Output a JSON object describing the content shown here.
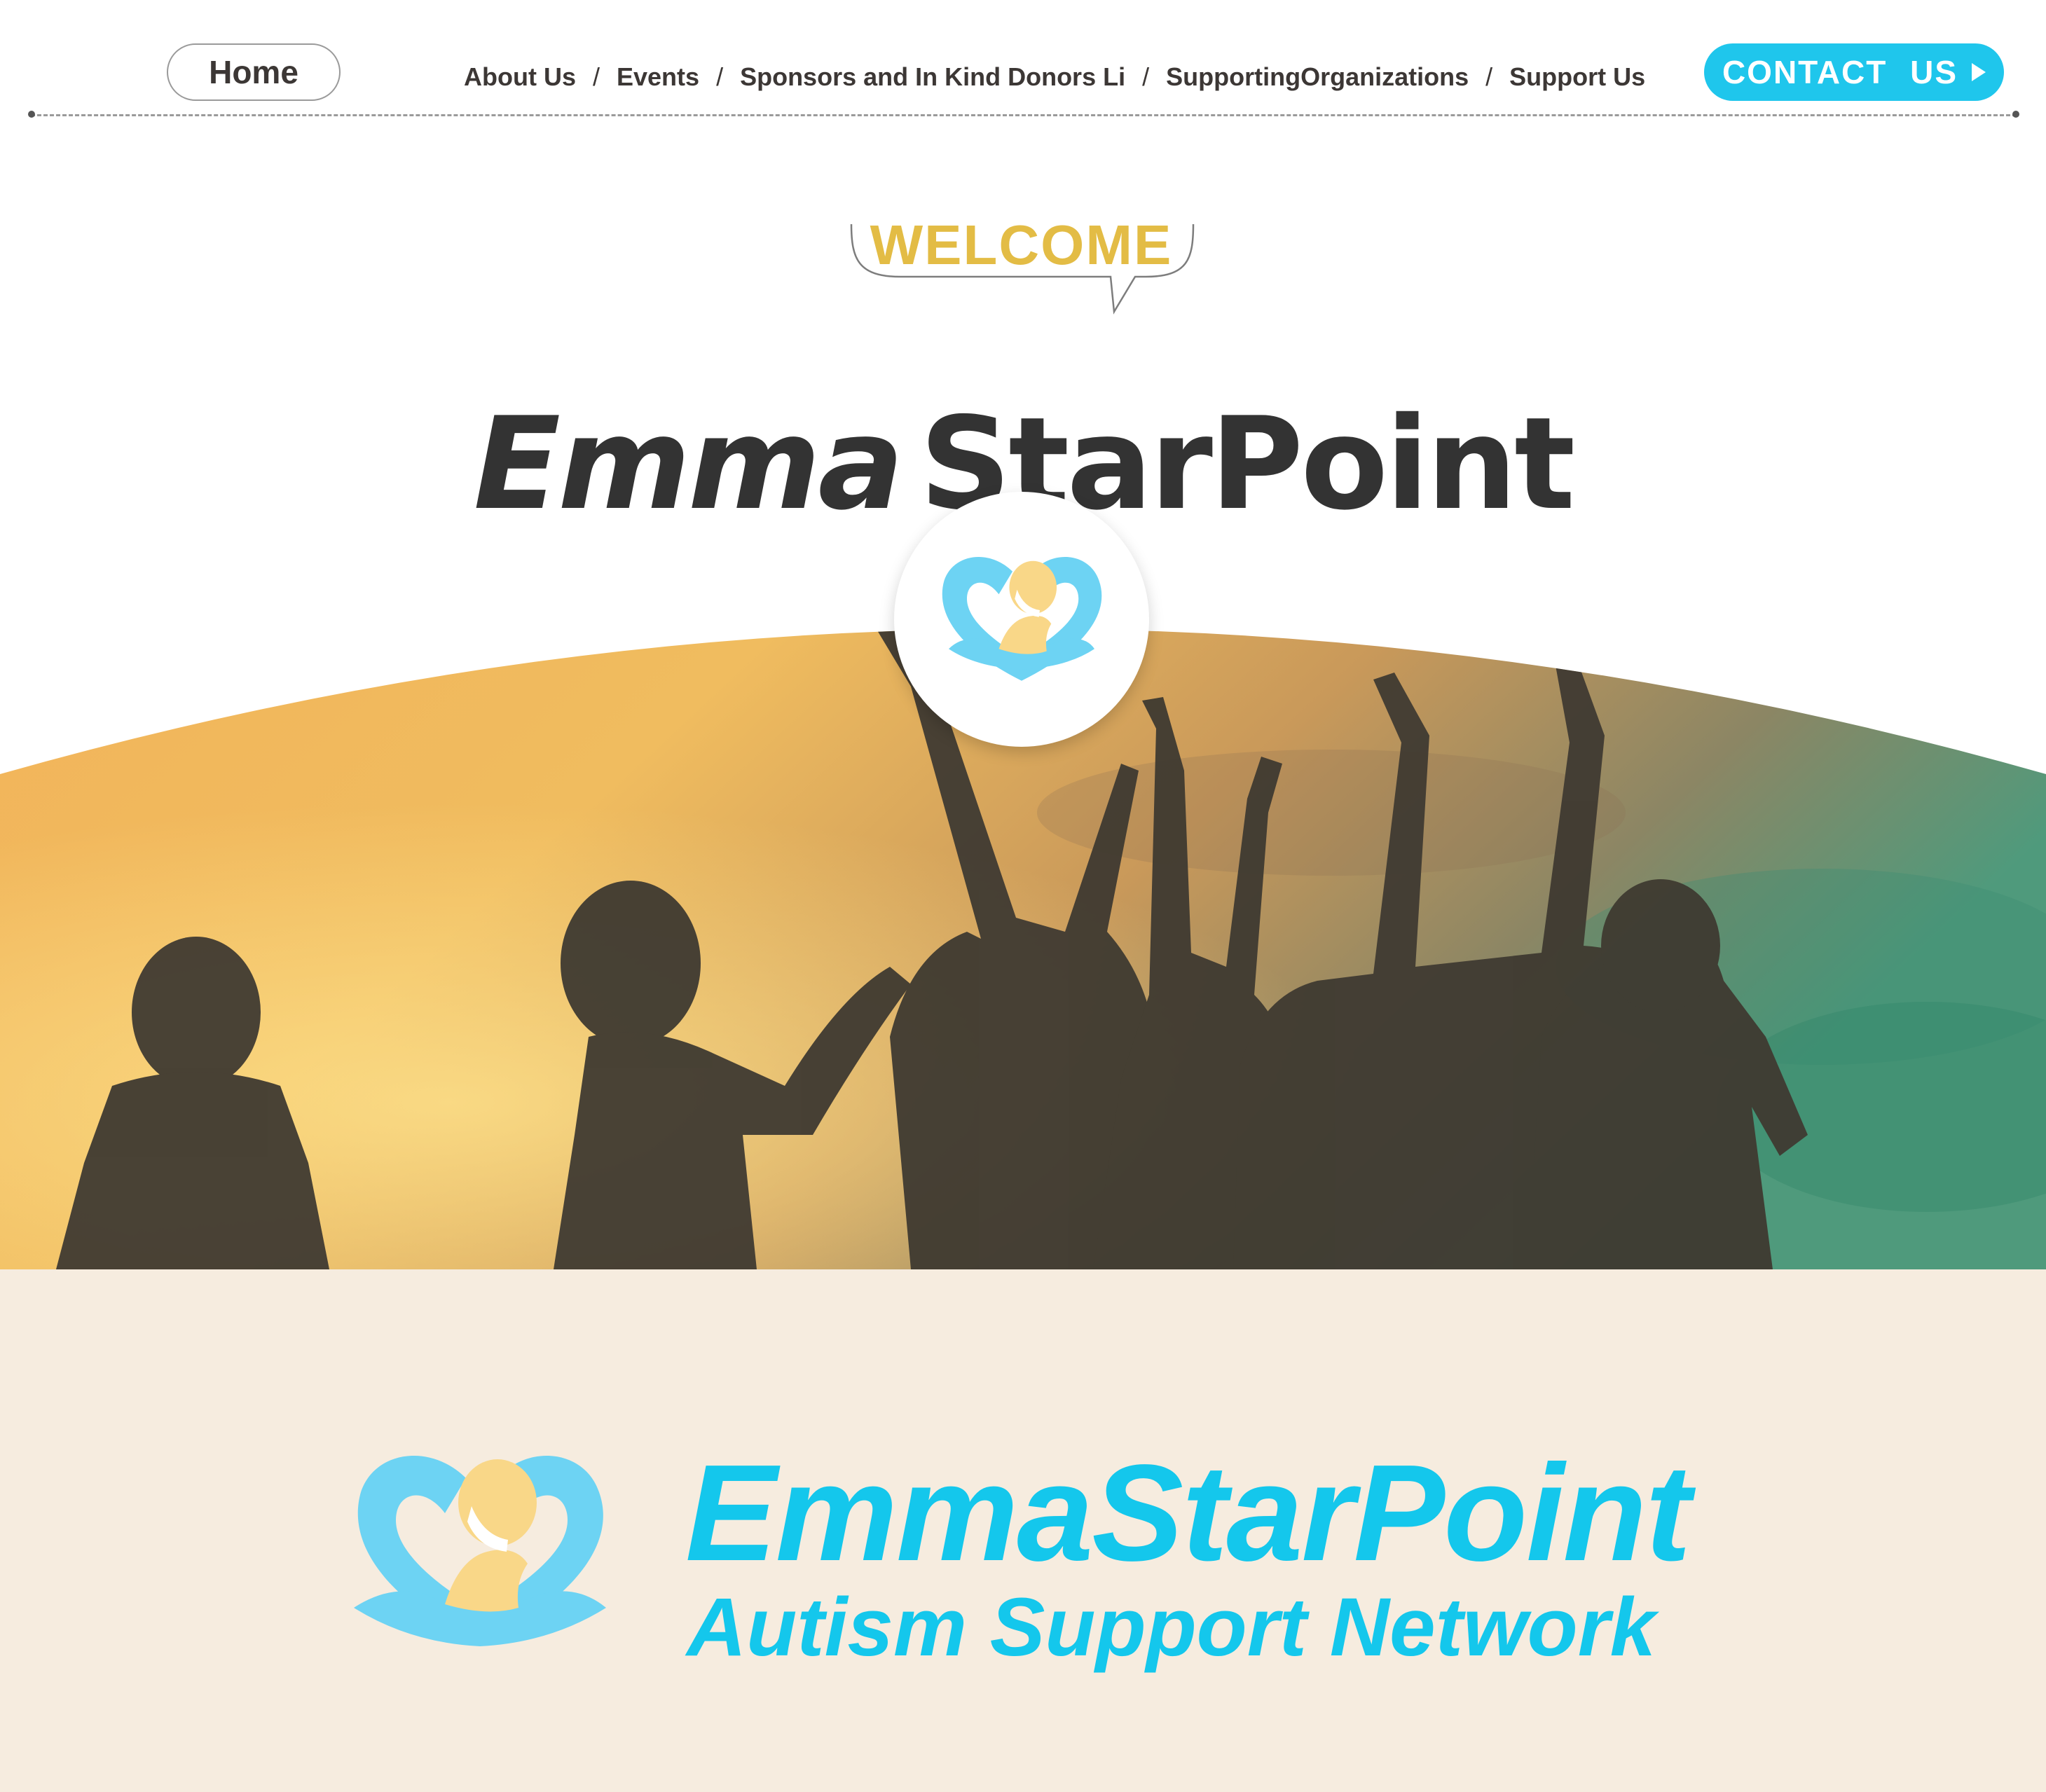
{
  "nav": {
    "home": "Home",
    "links": [
      "About Us",
      "Events",
      "Sponsors and In Kind Donors Li",
      "SupportingOrganizations",
      "Support Us"
    ],
    "separator": "/",
    "contact": "CONTACT US"
  },
  "hero": {
    "welcome": "WELCOME",
    "title_part1": "Emma",
    "title_part2": "StarPoint",
    "image_icon": "children-silhouettes-sunset-image",
    "logo_icon": "heart-child-logo-icon"
  },
  "brand": {
    "name": "EmmaStarPoint",
    "tagline": "Autism Support Network",
    "logo_icon": "heart-child-logo-icon"
  },
  "colors": {
    "accent": "#1fc6ec",
    "brand_text": "#14c7ec",
    "welcome": "#e3bc45",
    "band_background": "#f6ecdf",
    "heading": "#333333",
    "logo_blue": "#6dd3f3",
    "logo_yellow": "#f9d788"
  }
}
